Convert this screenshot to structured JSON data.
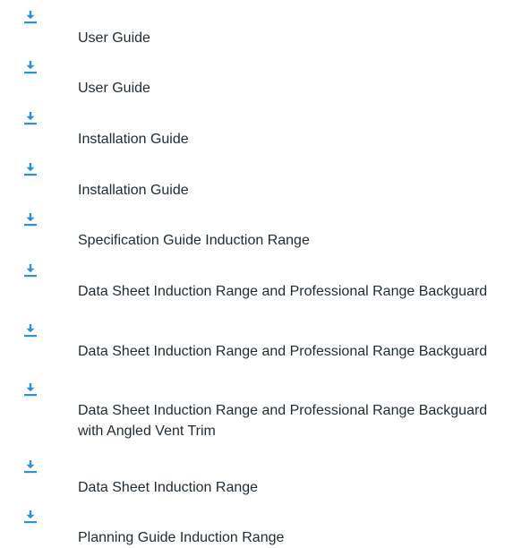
{
  "downloads": {
    "icon": "download-icon",
    "icon_color": "#2f8fd8",
    "text_color": "#1f2b33",
    "items": [
      {
        "title": "User Guide"
      },
      {
        "title": "User Guide"
      },
      {
        "title": "Installation Guide"
      },
      {
        "title": "Installation Guide"
      },
      {
        "title": "Specification Guide Induction Range"
      },
      {
        "title": "Data Sheet Induction Range and Professional Range Backguard"
      },
      {
        "title": "Data Sheet Induction Range and Professional Range Backguard"
      },
      {
        "title": "Data Sheet Induction Range and Professional Range Backguard with Angled Vent Trim"
      },
      {
        "title": "Data Sheet Induction Range"
      },
      {
        "title": "Planning Guide Induction Range"
      }
    ]
  }
}
